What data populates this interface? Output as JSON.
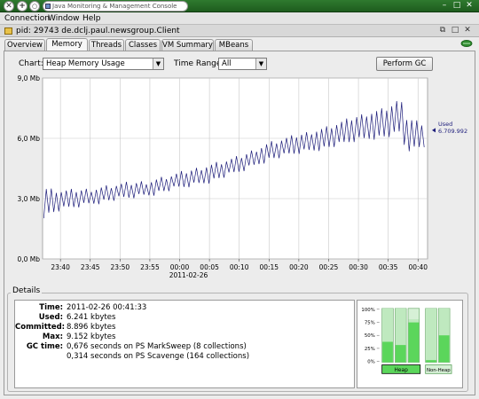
{
  "window": {
    "title": "Java Monitoring & Management Console"
  },
  "menu": [
    "Connection",
    "Window",
    "Help"
  ],
  "connection": {
    "label": "pid: 29743 de.dclj.paul.newsgroup.Client"
  },
  "tabs": [
    "Overview",
    "Memory",
    "Threads",
    "Classes",
    "VM Summary",
    "MBeans"
  ],
  "active_tab": "Memory",
  "controls": {
    "chart_label": "Chart:",
    "chart_value": "Heap Memory Usage",
    "time_range_label": "Time Range:",
    "time_range_value": "All",
    "gc_button": "Perform GC"
  },
  "chart_data": {
    "type": "line",
    "series": [
      {
        "name": "Used",
        "color": "#1c1c7a"
      }
    ],
    "ylim": [
      0,
      9
    ],
    "yticks": [
      "0,0 Mb",
      "3,0 Mb",
      "6,0 Mb",
      "9,0 Mb"
    ],
    "xticks": [
      "23:40",
      "23:45",
      "23:50",
      "23:55",
      "00:00",
      "00:05",
      "00:10",
      "00:15",
      "00:20",
      "00:25",
      "00:30",
      "00:35",
      "00:40"
    ],
    "xsub": "2011-02-26",
    "trend": [
      {
        "t": "23:37",
        "low": 2.0,
        "high": 3.6
      },
      {
        "t": "23:40",
        "low": 2.35,
        "high": 3.45
      },
      {
        "t": "23:45",
        "low": 2.65,
        "high": 3.55
      },
      {
        "t": "23:50",
        "low": 2.9,
        "high": 3.8
      },
      {
        "t": "23:55",
        "low": 3.1,
        "high": 3.95
      },
      {
        "t": "00:00",
        "low": 3.45,
        "high": 4.35
      },
      {
        "t": "00:05",
        "low": 3.75,
        "high": 4.75
      },
      {
        "t": "00:10",
        "low": 4.25,
        "high": 5.15
      },
      {
        "t": "00:15",
        "low": 4.85,
        "high": 5.85
      },
      {
        "t": "00:20",
        "low": 5.2,
        "high": 6.25
      },
      {
        "t": "00:25",
        "low": 5.45,
        "high": 6.65
      },
      {
        "t": "00:30",
        "low": 5.85,
        "high": 7.2
      },
      {
        "t": "00:35",
        "low": 6.0,
        "high": 7.6
      },
      {
        "t": "00:37",
        "low": 6.2,
        "high": 8.05
      },
      {
        "t": "00:38",
        "low": 5.3,
        "high": 7.1
      },
      {
        "t": "00:41",
        "low": 5.5,
        "high": 6.8
      }
    ],
    "legend_label": "Used",
    "legend_value": "6.709.992"
  },
  "details": {
    "title": "Details",
    "rows": [
      {
        "key": "Time:",
        "value": "2011-02-26 00:41:33"
      },
      {
        "key": "Used:",
        "value": "6.241 kbytes"
      },
      {
        "key": "Committed:",
        "value": "8.896 kbytes"
      },
      {
        "key": "Max:",
        "value": "9.152 kbytes"
      },
      {
        "key": "GC time:",
        "value": "0,676 seconds on PS MarkSweep (8 collections)"
      },
      {
        "key": "",
        "value": "0,314 seconds on PS Scavenge (164 collections)"
      }
    ]
  },
  "gauges": {
    "ticks": [
      "100%",
      "75%",
      "50%",
      "25%",
      "0%"
    ],
    "heap_label": "Heap",
    "nonheap_label": "Non-Heap",
    "heap_bars": [
      {
        "used": 0.38,
        "committed": 1.0
      },
      {
        "used": 0.32,
        "committed": 1.0
      },
      {
        "used": 0.74,
        "committed": 0.8
      }
    ],
    "nonheap_bars": [
      {
        "used": 0.04,
        "committed": 1.0
      },
      {
        "used": 0.5,
        "committed": 1.0
      }
    ]
  }
}
